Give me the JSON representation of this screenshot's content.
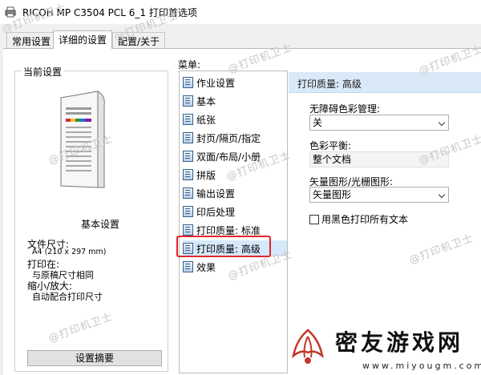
{
  "window": {
    "title": "RICOH MP C3504 PCL 6_1 打印首选项"
  },
  "tabs": [
    {
      "label": "常用设置",
      "active": false
    },
    {
      "label": "详细的设置",
      "active": true
    },
    {
      "label": "配置/关于",
      "active": false
    }
  ],
  "current_settings": {
    "group_label": "当前设置",
    "basic_title": "基本设置",
    "paper_size_label": "文件尺寸:",
    "paper_size_value": "A4 (210 x 297 mm)",
    "print_on_label": "打印在:",
    "print_on_value": "与原稿尺寸相同",
    "zoom_label": "缩小/放大:",
    "zoom_value": "自动配合打印尺寸",
    "summary_button": "设置摘要"
  },
  "menu": {
    "label": "菜单:",
    "items": [
      {
        "label": "作业设置",
        "icon": "job-settings-icon"
      },
      {
        "label": "基本",
        "icon": "basic-icon"
      },
      {
        "label": "纸张",
        "icon": "paper-icon"
      },
      {
        "label": "封页/隔页/指定",
        "icon": "cover-icon"
      },
      {
        "label": "双面/布局/小册",
        "icon": "duplex-icon"
      },
      {
        "label": "拼版",
        "icon": "imposition-icon"
      },
      {
        "label": "输出设置",
        "icon": "output-icon"
      },
      {
        "label": "印后处理",
        "icon": "finishing-icon"
      },
      {
        "label": "打印质量: 标准",
        "icon": "quality-standard-icon"
      },
      {
        "label": "打印质量: 高级",
        "icon": "quality-advanced-icon",
        "selected": true
      },
      {
        "label": "效果",
        "icon": "effects-icon"
      }
    ]
  },
  "detail_panel": {
    "header": "打印质量: 高级",
    "color_management_label": "无障碍色彩管理:",
    "color_management_value": "关",
    "color_balance_label": "色彩平衡:",
    "color_balance_value": "整个文档",
    "vector_label": "矢量图形/光栅图形:",
    "vector_value": "矢量图形",
    "black_text_checkbox": "用黑色打印所有文本",
    "black_text_checked": false
  },
  "watermark_text": "@打印机卫士",
  "logo": {
    "name": "密友游戏网",
    "url": "www.miyougm.com"
  },
  "colors": {
    "highlight": "#e0262c",
    "header_bg": "#d9e9f7",
    "selected_bg": "#d6e8fb"
  }
}
